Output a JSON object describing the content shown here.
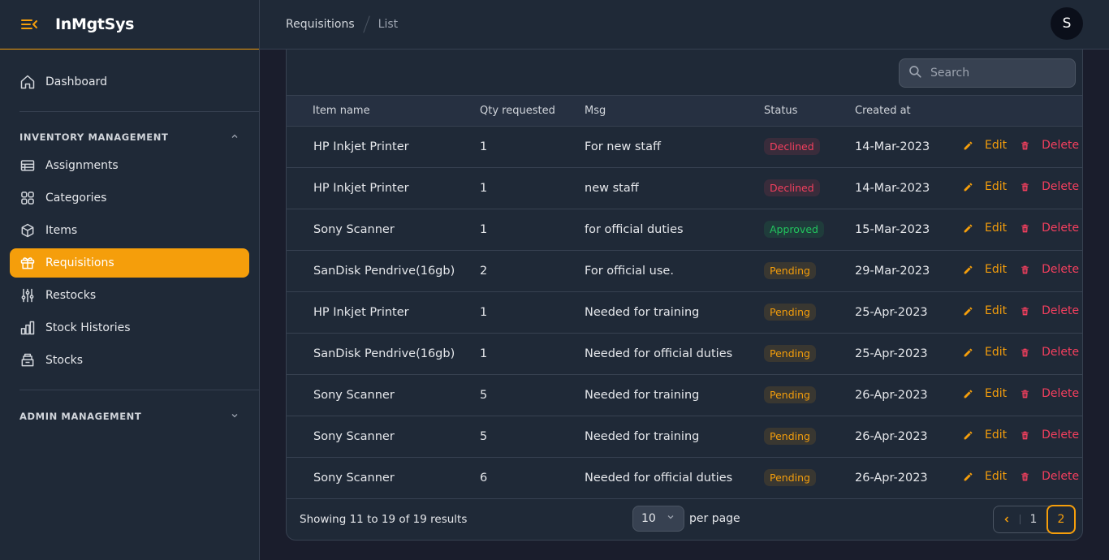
{
  "app": {
    "name": "InMgtSys"
  },
  "sidebar": {
    "dashboard": "Dashboard",
    "groups": [
      {
        "title": "INVENTORY MANAGEMENT",
        "items": [
          {
            "label": "Assignments",
            "icon": "table-icon"
          },
          {
            "label": "Categories",
            "icon": "grid-icon"
          },
          {
            "label": "Items",
            "icon": "cube-icon"
          },
          {
            "label": "Requisitions",
            "icon": "gift-icon",
            "active": true
          },
          {
            "label": "Restocks",
            "icon": "sliders-icon"
          },
          {
            "label": "Stock Histories",
            "icon": "bar-chart-icon"
          },
          {
            "label": "Stocks",
            "icon": "box-icon"
          }
        ]
      },
      {
        "title": "ADMIN MANAGEMENT",
        "items": []
      }
    ]
  },
  "breadcrumb": {
    "parent": "Requisitions",
    "current": "List"
  },
  "user": {
    "initial": "S"
  },
  "search": {
    "placeholder": "Search"
  },
  "table": {
    "headers": [
      "Item name",
      "Qty requested",
      "Msg",
      "Status",
      "Created at"
    ],
    "rows": [
      {
        "item": "HP Inkjet Printer",
        "qty": "1",
        "msg": "For new staff",
        "status": "Declined",
        "created": "14-Mar-2023"
      },
      {
        "item": "HP Inkjet Printer",
        "qty": "1",
        "msg": "new staff",
        "status": "Declined",
        "created": "14-Mar-2023"
      },
      {
        "item": "Sony Scanner",
        "qty": "1",
        "msg": "for official duties",
        "status": "Approved",
        "created": "15-Mar-2023"
      },
      {
        "item": "SanDisk Pendrive(16gb)",
        "qty": "2",
        "msg": "For official use.",
        "status": "Pending",
        "created": "29-Mar-2023"
      },
      {
        "item": "HP Inkjet Printer",
        "qty": "1",
        "msg": "Needed for training",
        "status": "Pending",
        "created": "25-Apr-2023"
      },
      {
        "item": "SanDisk Pendrive(16gb)",
        "qty": "1",
        "msg": "Needed for official duties",
        "status": "Pending",
        "created": "25-Apr-2023"
      },
      {
        "item": "Sony Scanner",
        "qty": "5",
        "msg": "Needed for training",
        "status": "Pending",
        "created": "26-Apr-2023"
      },
      {
        "item": "Sony Scanner",
        "qty": "5",
        "msg": "Needed for training",
        "status": "Pending",
        "created": "26-Apr-2023"
      },
      {
        "item": "Sony Scanner",
        "qty": "6",
        "msg": "Needed for official duties",
        "status": "Pending",
        "created": "26-Apr-2023"
      }
    ],
    "edit_label": "Edit",
    "delete_label": "Delete"
  },
  "footer": {
    "showing": "Showing 11 to 19 of 19 results",
    "per_page_value": "10",
    "per_page_label": "per page",
    "pages": [
      "1",
      "2"
    ],
    "current_page": "2"
  },
  "colors": {
    "accent": "#f59e0b",
    "danger": "#f43f5e",
    "success": "#22c55e",
    "sidebar_bg": "#1f2937",
    "page_bg": "#1a1d2c"
  }
}
